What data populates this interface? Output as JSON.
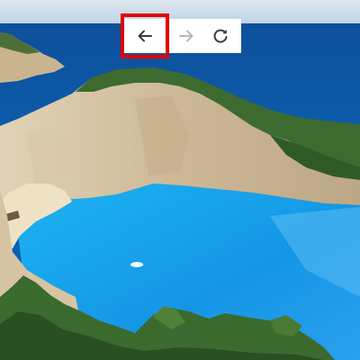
{
  "image": {
    "subject": "beach-photo",
    "colors": {
      "sky": "#c9d9e8",
      "sea_deep": "#0b5cae",
      "lagoon": "#1aa6ef",
      "cliff": "#d8c6a6",
      "vegetation": "#3a6b2e",
      "sand": "#efe2c4"
    }
  },
  "toolbar": {
    "back_icon": "arrow-left",
    "forward_icon": "arrow-right",
    "reload_icon": "reload",
    "back_enabled": true,
    "forward_enabled": false,
    "reload_enabled": true,
    "highlight_color": "#e00000"
  }
}
